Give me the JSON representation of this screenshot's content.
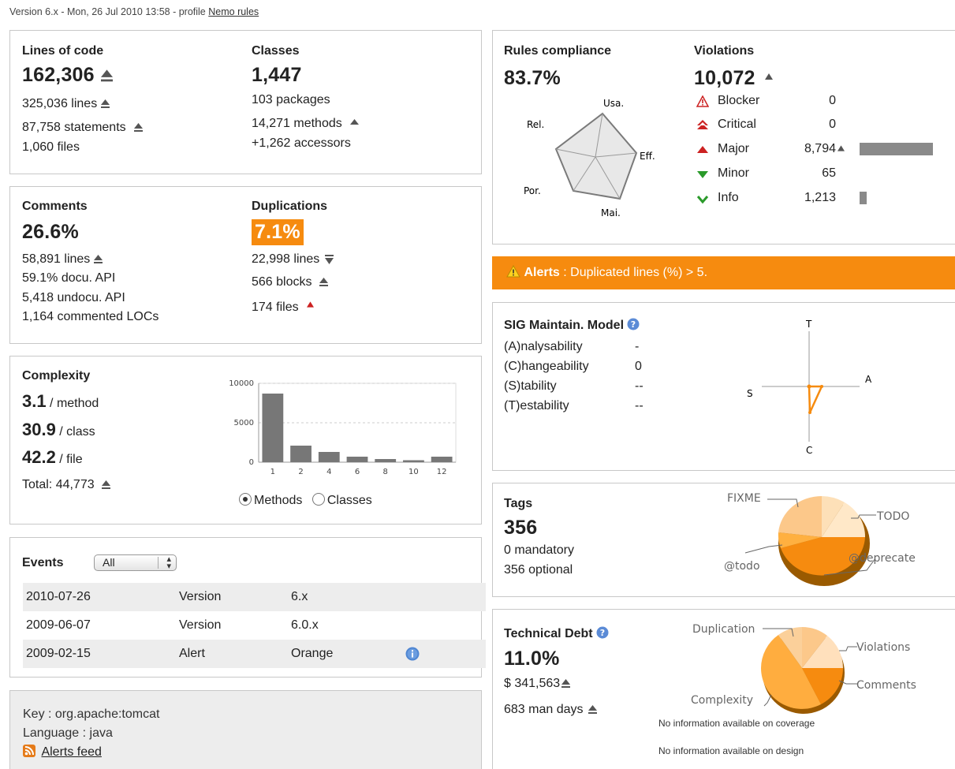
{
  "header": {
    "text": "Version 6.x - Mon, 26 Jul 2010 13:58 - profile",
    "profile_link": "Nemo rules"
  },
  "size": {
    "loc_title": "Lines of code",
    "loc_value": "162,306",
    "lines": "325,036 lines",
    "statements": "87,758 statements",
    "files": "1,060 files",
    "classes_title": "Classes",
    "classes_value": "1,447",
    "packages": "103 packages",
    "methods": "14,271 methods",
    "accessors": "+1,262 accessors"
  },
  "comments": {
    "title": "Comments",
    "value": "26.6%",
    "lines": "58,891 lines",
    "docu_api": "59.1% docu. API",
    "undocu_api": "5,418 undocu. API",
    "commented_locs": "1,164 commented LOCs"
  },
  "duplications": {
    "title": "Duplications",
    "value": "7.1%",
    "lines": "22,998 lines",
    "blocks": "566 blocks",
    "files": "174 files"
  },
  "complexity": {
    "title": "Complexity",
    "per_method": "3.1",
    "per_method_unit": "/ method",
    "per_class": "30.9",
    "per_class_unit": "/ class",
    "per_file": "42.2",
    "per_file_unit": "/ file",
    "total": "Total: 44,773",
    "radio_methods": "Methods",
    "radio_classes": "Classes"
  },
  "chart_data": {
    "type": "bar",
    "categories": [
      "1",
      "2",
      "4",
      "6",
      "8",
      "10",
      "12"
    ],
    "values": [
      8700,
      2100,
      1300,
      700,
      400,
      250,
      700
    ],
    "ylim": [
      0,
      10000
    ],
    "yticks": [
      "0",
      "5000",
      "10000"
    ],
    "grid": true
  },
  "events": {
    "title": "Events",
    "filter_value": "All",
    "rows": [
      {
        "date": "2010-07-26",
        "category": "Version",
        "name": "6.x",
        "info": false
      },
      {
        "date": "2009-06-07",
        "category": "Version",
        "name": "6.0.x",
        "info": false
      },
      {
        "date": "2009-02-15",
        "category": "Alert",
        "name": "Orange",
        "info": true
      }
    ]
  },
  "project": {
    "key": "Key : org.apache:tomcat",
    "language": "Language : java",
    "feed": "Alerts feed"
  },
  "rules": {
    "title": "Rules compliance",
    "value": "83.7%",
    "radar_labels": {
      "usa": "Usa.",
      "rel": "Rel.",
      "eff": "Eff.",
      "por": "Por.",
      "mai": "Mai."
    }
  },
  "violations": {
    "title": "Violations",
    "value": "10,072",
    "items": [
      {
        "label": "Blocker",
        "count": "0",
        "bar": 0
      },
      {
        "label": "Critical",
        "count": "0",
        "bar": 0
      },
      {
        "label": "Major",
        "count": "8,794",
        "bar": 1.0
      },
      {
        "label": "Minor",
        "count": "65",
        "bar": 0
      },
      {
        "label": "Info",
        "count": "1,213",
        "bar": 0.1
      }
    ]
  },
  "alerts": {
    "label": "Alerts",
    "text": ": Duplicated lines (%) > 5."
  },
  "sig": {
    "title": "SIG Maintain. Model",
    "rows": [
      {
        "label": "(A)nalysability",
        "value": "-"
      },
      {
        "label": "(C)hangeability",
        "value": "0"
      },
      {
        "label": "(S)tability",
        "value": "--"
      },
      {
        "label": "(T)estability",
        "value": "--"
      }
    ],
    "axis_t": "T",
    "axis_a": "A",
    "axis_s": "S",
    "axis_c": "C"
  },
  "tags": {
    "title": "Tags",
    "value": "356",
    "mandatory": "0 mandatory",
    "optional": "356 optional",
    "pie_labels": {
      "fixme": "FIXME",
      "todo_upper": "TODO",
      "todo_lower": "@todo",
      "deprecate": "@deprecate"
    }
  },
  "debt": {
    "title": "Technical Debt",
    "value": "11.0%",
    "cost": "$ 341,563",
    "days": "683 man days",
    "pie_labels": {
      "duplication": "Duplication",
      "violations": "Violations",
      "comments": "Comments",
      "complexity": "Complexity"
    },
    "no_coverage": "No information available on coverage",
    "no_design": "No information available on design"
  },
  "colors": {
    "orange": "#f68b0f",
    "bar_gray": "#777777"
  }
}
